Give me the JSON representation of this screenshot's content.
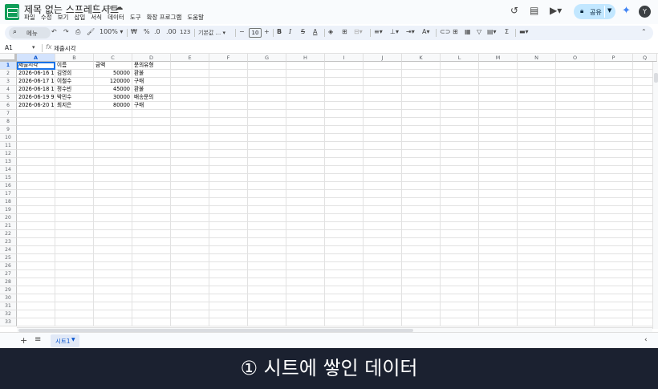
{
  "document": {
    "title": "제목 없는 스프레드시트",
    "menu": [
      "파일",
      "수정",
      "보기",
      "삽입",
      "서식",
      "데이터",
      "도구",
      "확장 프로그램",
      "도움말"
    ],
    "share_label": "공유",
    "avatar_initial": "Y"
  },
  "toolbar": {
    "search_label": "메뉴",
    "zoom": "100%",
    "currency": "₩",
    "percent": "%",
    "dec_dec": ".0",
    "dec_inc": ".00",
    "num_format": "123",
    "font_name": "기본값 ...",
    "font_size": "10"
  },
  "formula_bar": {
    "cell_ref": "A1",
    "value": "제출시각"
  },
  "grid": {
    "columns": [
      "A",
      "B",
      "C",
      "D",
      "E",
      "F",
      "G",
      "H",
      "I",
      "J",
      "K",
      "L",
      "M",
      "N",
      "O",
      "P",
      "Q"
    ],
    "row_count": 33,
    "rows": [
      [
        "제출시각",
        "이름",
        "금액",
        "문의유형"
      ],
      [
        "2026-06-16 10:1",
        "김영희",
        "50000",
        "환불"
      ],
      [
        "2026-06-17 14:0",
        "이철수",
        "120000",
        "구매"
      ],
      [
        "2026-06-18 11:2",
        "정수빈",
        "45000",
        "환불"
      ],
      [
        "2026-06-19 9:41",
        "박민수",
        "30000",
        "배송문의"
      ],
      [
        "2026-06-20 16:5",
        "최지은",
        "80000",
        "구매"
      ]
    ],
    "numeric_columns": [
      2
    ]
  },
  "sheets": {
    "tabs": [
      "시트1"
    ]
  },
  "caption": "① 시트에 쌓인 데이터"
}
